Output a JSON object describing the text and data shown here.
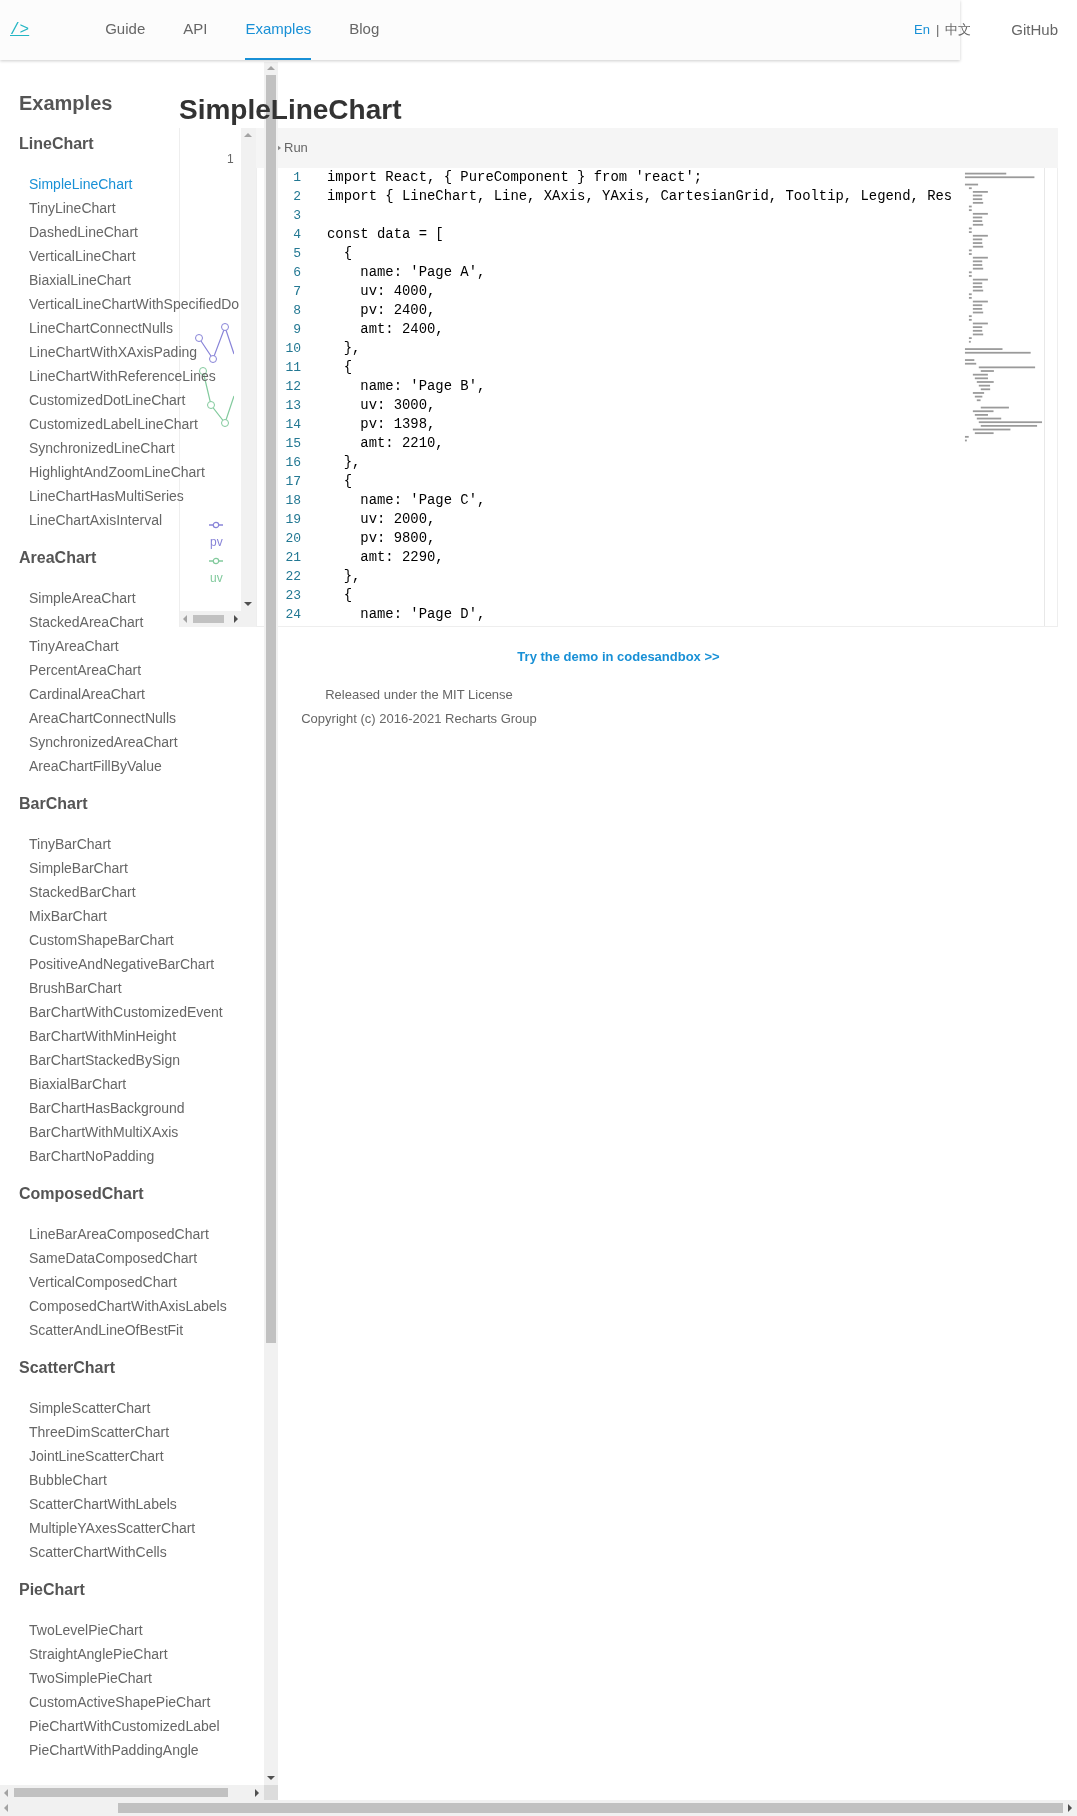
{
  "header": {
    "logo": "/>",
    "nav": [
      {
        "label": "Guide",
        "selected": false
      },
      {
        "label": "API",
        "selected": false
      },
      {
        "label": "Examples",
        "selected": true
      },
      {
        "label": "Blog",
        "selected": false
      }
    ],
    "languages": [
      {
        "label": "En",
        "selected": true
      },
      {
        "label": "中文",
        "selected": false
      }
    ],
    "language_separator": "|",
    "github": "GitHub"
  },
  "sidebar": {
    "title": "Examples",
    "groups": [
      {
        "title": "LineChart",
        "items": [
          {
            "label": "SimpleLineChart",
            "selected": true
          },
          {
            "label": "TinyLineChart",
            "selected": false
          },
          {
            "label": "DashedLineChart",
            "selected": false
          },
          {
            "label": "VerticalLineChart",
            "selected": false
          },
          {
            "label": "BiaxialLineChart",
            "selected": false
          },
          {
            "label": "VerticalLineChartWithSpecifiedDo",
            "selected": false
          },
          {
            "label": "LineChartConnectNulls",
            "selected": false
          },
          {
            "label": "LineChartWithXAxisPading",
            "selected": false
          },
          {
            "label": "LineChartWithReferenceLines",
            "selected": false
          },
          {
            "label": "CustomizedDotLineChart",
            "selected": false
          },
          {
            "label": "CustomizedLabelLineChart",
            "selected": false
          },
          {
            "label": "SynchronizedLineChart",
            "selected": false
          },
          {
            "label": "HighlightAndZoomLineChart",
            "selected": false
          },
          {
            "label": "LineChartHasMultiSeries",
            "selected": false
          },
          {
            "label": "LineChartAxisInterval",
            "selected": false
          }
        ]
      },
      {
        "title": "AreaChart",
        "items": [
          {
            "label": "SimpleAreaChart",
            "selected": false
          },
          {
            "label": "StackedAreaChart",
            "selected": false
          },
          {
            "label": "TinyAreaChart",
            "selected": false
          },
          {
            "label": "PercentAreaChart",
            "selected": false
          },
          {
            "label": "CardinalAreaChart",
            "selected": false
          },
          {
            "label": "AreaChartConnectNulls",
            "selected": false
          },
          {
            "label": "SynchronizedAreaChart",
            "selected": false
          },
          {
            "label": "AreaChartFillByValue",
            "selected": false
          }
        ]
      },
      {
        "title": "BarChart",
        "items": [
          {
            "label": "TinyBarChart",
            "selected": false
          },
          {
            "label": "SimpleBarChart",
            "selected": false
          },
          {
            "label": "StackedBarChart",
            "selected": false
          },
          {
            "label": "MixBarChart",
            "selected": false
          },
          {
            "label": "CustomShapeBarChart",
            "selected": false
          },
          {
            "label": "PositiveAndNegativeBarChart",
            "selected": false
          },
          {
            "label": "BrushBarChart",
            "selected": false
          },
          {
            "label": "BarChartWithCustomizedEvent",
            "selected": false
          },
          {
            "label": "BarChartWithMinHeight",
            "selected": false
          },
          {
            "label": "BarChartStackedBySign",
            "selected": false
          },
          {
            "label": "BiaxialBarChart",
            "selected": false
          },
          {
            "label": "BarChartHasBackground",
            "selected": false
          },
          {
            "label": "BarChartWithMultiXAxis",
            "selected": false
          },
          {
            "label": "BarChartNoPadding",
            "selected": false
          }
        ]
      },
      {
        "title": "ComposedChart",
        "items": [
          {
            "label": "LineBarAreaComposedChart",
            "selected": false
          },
          {
            "label": "SameDataComposedChart",
            "selected": false
          },
          {
            "label": "VerticalComposedChart",
            "selected": false
          },
          {
            "label": "ComposedChartWithAxisLabels",
            "selected": false
          },
          {
            "label": "ScatterAndLineOfBestFit",
            "selected": false
          }
        ]
      },
      {
        "title": "ScatterChart",
        "items": [
          {
            "label": "SimpleScatterChart",
            "selected": false
          },
          {
            "label": "ThreeDimScatterChart",
            "selected": false
          },
          {
            "label": "JointLineScatterChart",
            "selected": false
          },
          {
            "label": "BubbleChart",
            "selected": false
          },
          {
            "label": "ScatterChartWithLabels",
            "selected": false
          },
          {
            "label": "MultipleYAxesScatterChart",
            "selected": false
          },
          {
            "label": "ScatterChartWithCells",
            "selected": false
          }
        ]
      },
      {
        "title": "PieChart",
        "items": [
          {
            "label": "TwoLevelPieChart",
            "selected": false
          },
          {
            "label": "StraightAnglePieChart",
            "selected": false
          },
          {
            "label": "TwoSimplePieChart",
            "selected": false
          },
          {
            "label": "CustomActiveShapePieChart",
            "selected": false
          },
          {
            "label": "PieChartWithCustomizedLabel",
            "selected": false
          },
          {
            "label": "PieChartWithPaddingAngle",
            "selected": false
          }
        ]
      }
    ]
  },
  "main": {
    "title": "SimpleLineChart",
    "preview": {
      "tick": "1",
      "legend": [
        {
          "label": "pv",
          "color": "#8884d8"
        },
        {
          "label": "uv",
          "color": "#82ca9d"
        }
      ]
    },
    "run_label": "Run",
    "code_lines": [
      {
        "number": "1",
        "code": "import React, { PureComponent } from 'react';"
      },
      {
        "number": "2",
        "code": "import { LineChart, Line, XAxis, YAxis, CartesianGrid, Tooltip, Legend, Res"
      },
      {
        "number": "3"
      },
      {
        "number": "4",
        "code": "const data = ["
      },
      {
        "number": "5",
        "code": "  {"
      },
      {
        "number": "6",
        "code": "    name: 'Page A',"
      },
      {
        "number": "7",
        "code": "    uv: 4000,"
      },
      {
        "number": "8",
        "code": "    pv: 2400,"
      },
      {
        "number": "9",
        "code": "    amt: 2400,"
      },
      {
        "number": "10",
        "code": "  },"
      },
      {
        "number": "11",
        "code": "  {"
      },
      {
        "number": "12",
        "code": "    name: 'Page B',"
      },
      {
        "number": "13",
        "code": "    uv: 3000,"
      },
      {
        "number": "14",
        "code": "    pv: 1398,"
      },
      {
        "number": "15",
        "code": "    amt: 2210,"
      },
      {
        "number": "16",
        "code": "  },"
      },
      {
        "number": "17",
        "code": "  {"
      },
      {
        "number": "18",
        "code": "    name: 'Page C',"
      },
      {
        "number": "19",
        "code": "    uv: 2000,"
      },
      {
        "number": "20",
        "code": "    pv: 9800,"
      },
      {
        "number": "21",
        "code": "    amt: 2290,"
      },
      {
        "number": "22",
        "code": "  },"
      },
      {
        "number": "23",
        "code": "  {"
      },
      {
        "number": "24",
        "code": "    name: 'Page D',"
      }
    ],
    "demo_link": "Try the demo in codesandbox >>",
    "footer": [
      "Released under the MIT License",
      "Copyright (c) 2016-2021 Recharts Group"
    ]
  }
}
